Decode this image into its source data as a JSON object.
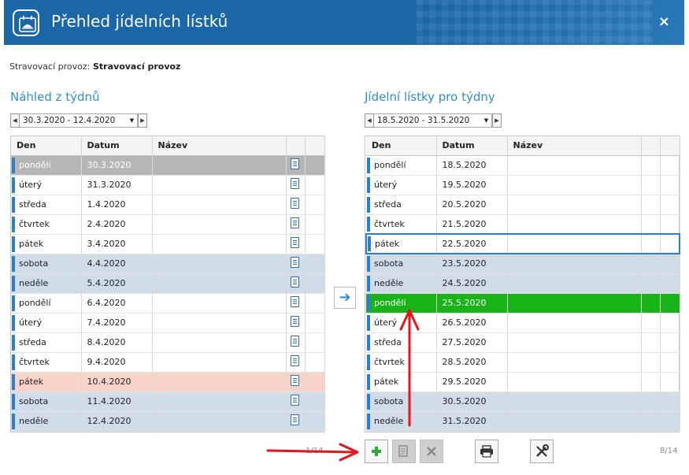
{
  "window": {
    "title": "Přehled jídelních lístků",
    "close_label": "×"
  },
  "provoz": {
    "label": "Stravovací provoz:",
    "value": "Stravovací provoz"
  },
  "left": {
    "title": "Náhled z týdnů",
    "range": "30.3.2020 - 12.4.2020",
    "columns": [
      "Den",
      "Datum",
      "Název"
    ],
    "rows": [
      {
        "day": "pondělí",
        "date": "30.3.2020"
      },
      {
        "day": "úterý",
        "date": "31.3.2020"
      },
      {
        "day": "středa",
        "date": "1.4.2020"
      },
      {
        "day": "čtvrtek",
        "date": "2.4.2020"
      },
      {
        "day": "pátek",
        "date": "3.4.2020"
      },
      {
        "day": "sobota",
        "date": "4.4.2020"
      },
      {
        "day": "neděle",
        "date": "5.4.2020"
      },
      {
        "day": "pondělí",
        "date": "6.4.2020"
      },
      {
        "day": "úterý",
        "date": "7.4.2020"
      },
      {
        "day": "středa",
        "date": "8.4.2020"
      },
      {
        "day": "čtvrtek",
        "date": "9.4.2020"
      },
      {
        "day": "pátek",
        "date": "10.4.2020"
      },
      {
        "day": "sobota",
        "date": "11.4.2020"
      },
      {
        "day": "neděle",
        "date": "12.4.2020"
      }
    ],
    "pager": "1/14"
  },
  "right": {
    "title": "Jídelní lístky pro týdny",
    "range": "18.5.2020 - 31.5.2020",
    "columns": [
      "Den",
      "Datum",
      "Název"
    ],
    "rows": [
      {
        "day": "pondělí",
        "date": "18.5.2020"
      },
      {
        "day": "úterý",
        "date": "19.5.2020"
      },
      {
        "day": "středa",
        "date": "20.5.2020"
      },
      {
        "day": "čtvrtek",
        "date": "21.5.2020"
      },
      {
        "day": "pátek",
        "date": "22.5.2020"
      },
      {
        "day": "sobota",
        "date": "23.5.2020"
      },
      {
        "day": "neděle",
        "date": "24.5.2020"
      },
      {
        "day": "pondělí",
        "date": "25.5.2020"
      },
      {
        "day": "úterý",
        "date": "26.5.2020"
      },
      {
        "day": "středa",
        "date": "27.5.2020"
      },
      {
        "day": "čtvrtek",
        "date": "28.5.2020"
      },
      {
        "day": "pátek",
        "date": "29.5.2020"
      },
      {
        "day": "sobota",
        "date": "30.5.2020"
      },
      {
        "day": "neděle",
        "date": "31.5.2020"
      }
    ],
    "pager": "8/14"
  },
  "colors": {
    "accent": "#2e8fd0",
    "titlebar": "#1a66a6",
    "selected_green": "#17b317",
    "selected_gray": "#b6b6b6",
    "weekend": "#d0dce8",
    "holiday": "#f8d3c9",
    "annotation_red": "#e8141a"
  },
  "icons": {
    "copy_arrow": "arrow-right-icon",
    "add": "plus-icon",
    "edit": "edit-document-icon",
    "delete": "x-icon",
    "print": "printer-icon",
    "settings": "wrench-screwdriver-icon"
  }
}
